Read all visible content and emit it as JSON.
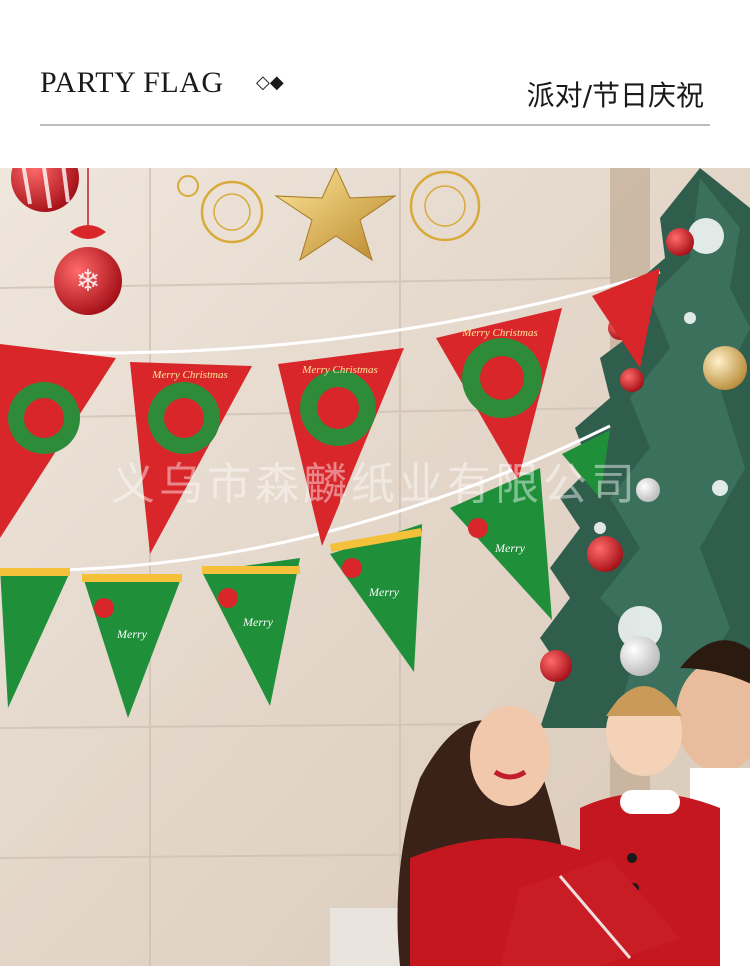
{
  "header": {
    "title_en": "PARTY FLAG",
    "diamonds": "◇◆",
    "title_cn": "派对/节日庆祝"
  },
  "photo": {
    "watermark": "义乌市森麟纸业有限公司",
    "flag_text_red": "Merry Christmas",
    "flag_text_green": "Merry"
  },
  "colors": {
    "flag_red": "#d8262a",
    "flag_green": "#1f8f3a",
    "gold": "#d9a93a",
    "wall": "#e6dcd2"
  }
}
